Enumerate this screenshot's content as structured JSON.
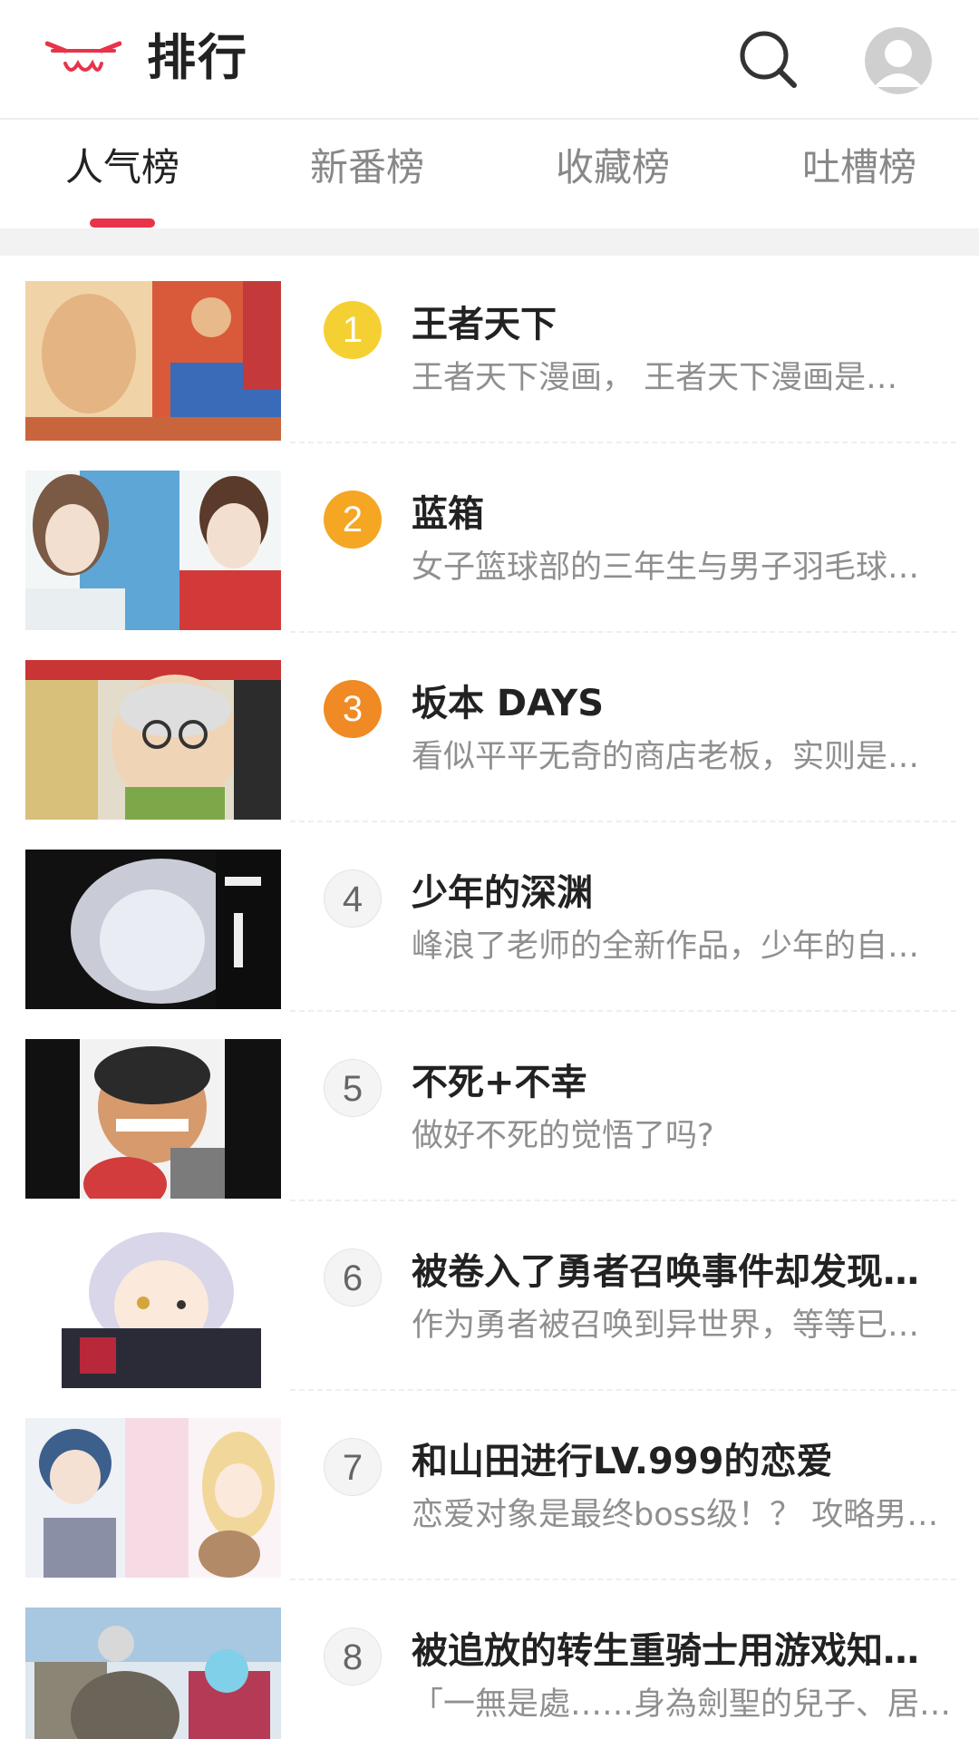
{
  "header": {
    "title": "排行",
    "logo_icon": "cat-face-logo-icon",
    "search_icon": "search-icon",
    "avatar_icon": "user-avatar-icon",
    "accent_color": "#e8334a"
  },
  "tabs": [
    {
      "label": "人气榜",
      "active": true
    },
    {
      "label": "新番榜",
      "active": false
    },
    {
      "label": "收藏榜",
      "active": false
    },
    {
      "label": "吐槽榜",
      "active": false
    }
  ],
  "ranking": [
    {
      "rank": "1",
      "title": "王者天下",
      "desc": "王者天下漫画， 王者天下漫画是…",
      "rank_color": "#f5d033"
    },
    {
      "rank": "2",
      "title": "蓝箱",
      "desc": "女子篮球部的三年生与男子羽毛球…",
      "rank_color": "#f5a623"
    },
    {
      "rank": "3",
      "title": "坂本 DAYS",
      "desc": "看似平平无奇的商店老板，实则是…",
      "rank_color": "#f08a24"
    },
    {
      "rank": "4",
      "title": "少年的深渊",
      "desc": "峰浪了老师的全新作品，少年的自…",
      "rank_color": "#f4f4f4"
    },
    {
      "rank": "5",
      "title": "不死+不幸",
      "desc": "做好不死的觉悟了吗?",
      "rank_color": "#f4f4f4"
    },
    {
      "rank": "6",
      "title": "被卷入了勇者召唤事件却发现…",
      "desc": "作为勇者被召唤到异世界，等等已…",
      "rank_color": "#f4f4f4"
    },
    {
      "rank": "7",
      "title": "和山田进行LV.999的恋爱",
      "desc": "恋爱对象是最终boss级！？ 攻略男…",
      "rank_color": "#f4f4f4"
    },
    {
      "rank": "8",
      "title": "被追放的转生重骑士用游戏知…",
      "desc": "「一無是處……身為劍聖的兒子、居…",
      "rank_color": "#f4f4f4"
    }
  ]
}
